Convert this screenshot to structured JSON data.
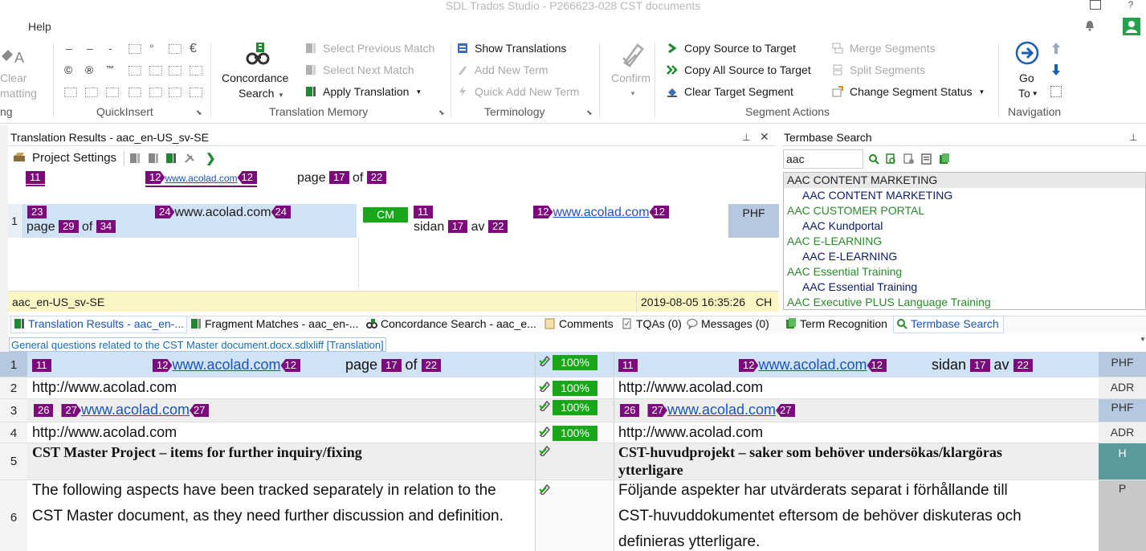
{
  "window": {
    "title": "SDL Trados Studio - P266623-028 CST documents"
  },
  "menu": {
    "help": "Help"
  },
  "ribbon": {
    "clear_formatting": [
      "Clear",
      "matting"
    ],
    "quickinsert": {
      "row1": [
        "–",
        "–",
        "-",
        "°",
        "€"
      ],
      "label": "QuickInsert",
      "symbols": [
        "©",
        "®",
        "™"
      ]
    },
    "concordance": {
      "line1": "Concordance",
      "line2": "Search"
    },
    "tm": {
      "select_prev": "Select Previous Match",
      "select_next": "Select Next Match",
      "apply": "Apply Translation",
      "label": "Translation Memory"
    },
    "terminology": {
      "show": "Show Translations",
      "add_new": "Add New Term",
      "quick_add": "Quick Add New Term",
      "label": "Terminology"
    },
    "confirm": "Confirm",
    "segment_actions": {
      "copy_source": "Copy Source to Target",
      "copy_all": "Copy All Source to Target",
      "clear_target": "Clear Target Segment",
      "merge": "Merge Segments",
      "split": "Split Segments",
      "change_status": "Change Segment Status",
      "label": "Segment Actions"
    },
    "navigation": {
      "go": "Go",
      "to": "To",
      "label": "Navigation"
    },
    "g_fragment": "ng"
  },
  "translation_results": {
    "title": "Translation Results - aac_en-US_sv-SE",
    "project_settings": "Project Settings",
    "preview": {
      "t11": "11",
      "t12a": "12",
      "link": "www.acolad.com",
      "t12b": "12",
      "page": "page",
      "t17": "17",
      "of": "of",
      "t22": "22"
    },
    "match": {
      "num": "1",
      "src": {
        "t23": "23",
        "t24a": "24",
        "text": "www.acolad.com",
        "t24b": "24",
        "page": "page",
        "t29": "29",
        "of": "of",
        "t34": "34"
      },
      "status": "CM",
      "tgt": {
        "t11": "11",
        "t12a": "12",
        "link": "www.acolad.com",
        "t12b": "12",
        "sidan": "sidan",
        "t17": "17",
        "av": "av",
        "t22": "22"
      },
      "code": "PHF"
    },
    "footer": {
      "tm": "aac_en-US_sv-SE",
      "date": "2019-08-05 16:35:26",
      "user": "CH"
    }
  },
  "termbase": {
    "title": "Termbase Search",
    "query": "aac",
    "results": [
      {
        "text": "AAC CONTENT MARKETING",
        "level": 0,
        "color": "#222222",
        "bg": "#e8e8e8"
      },
      {
        "text": "AAC CONTENT MARKETING",
        "level": 1,
        "color": "#0a1b6b",
        "bg": ""
      },
      {
        "text": "AAC CUSTOMER PORTAL",
        "level": 0,
        "color": "#2a8a2a",
        "bg": ""
      },
      {
        "text": "AAC Kundportal",
        "level": 1,
        "color": "#0a1b6b",
        "bg": ""
      },
      {
        "text": "AAC E-LEARNING",
        "level": 0,
        "color": "#2a8a2a",
        "bg": ""
      },
      {
        "text": "AAC E-LEARNING",
        "level": 1,
        "color": "#0a1b6b",
        "bg": ""
      },
      {
        "text": "AAC Essential Training",
        "level": 0,
        "color": "#2a8a2a",
        "bg": ""
      },
      {
        "text": "AAC Essential Training",
        "level": 1,
        "color": "#0a1b6b",
        "bg": ""
      },
      {
        "text": "AAC Executive PLUS Language Training",
        "level": 0,
        "color": "#2a8a2a",
        "bg": ""
      }
    ]
  },
  "tabs": [
    {
      "label": "Translation Results - aac_en-...",
      "active": true
    },
    {
      "label": "Fragment Matches - aac_en-..."
    },
    {
      "label": "Concordance Search - aac_e..."
    },
    {
      "label": "Comments"
    },
    {
      "label": "TQAs (0)"
    },
    {
      "label": "Messages (0)"
    },
    {
      "label": "Term Recognition"
    },
    {
      "label": "Termbase Search",
      "active": true
    }
  ],
  "editor": {
    "file": "General questions related to the CST Master document.docx.sdlxliff [Translation]",
    "rows": [
      {
        "num": "1",
        "match": "100%",
        "code": "PHF",
        "src": {
          "t11": "11",
          "t12a": "12",
          "link": "www.acolad.com",
          "t12b": "12",
          "page": "page",
          "t17": "17",
          "of": "of",
          "t22": "22"
        },
        "tgt": {
          "t11": "11",
          "t12a": "12",
          "link": "www.acolad.com",
          "t12b": "12",
          "sidan": "sidan",
          "t17": "17",
          "av": "av",
          "t22": "22"
        }
      },
      {
        "num": "2",
        "match": "100%",
        "code": "ADR",
        "src": "http://www.acolad.com",
        "tgt": "http://www.acolad.com"
      },
      {
        "num": "3",
        "match": "100%",
        "code": "PHF",
        "src": {
          "t26": "26",
          "t27a": "27",
          "link": "www.acolad.com",
          "t27b": "27"
        },
        "tgt": {
          "t26": "26",
          "t27a": "27",
          "link": "www.acolad.com",
          "t27b": "27"
        }
      },
      {
        "num": "4",
        "match": "100%",
        "code": "ADR",
        "src": "http://www.acolad.com",
        "tgt": "http://www.acolad.com"
      },
      {
        "num": "5",
        "code": "H",
        "src": "CST Master Project – items for further inquiry/fixing",
        "tgt1": "CST-huvudprojekt – saker som behöver undersökas/klargöras",
        "tgt2": "ytterligare"
      },
      {
        "num": "6",
        "code": "P",
        "src1": "The following aspects have been tracked separately in relation to the",
        "src2": "CST Master document, as they need further discussion and definition.",
        "tgt1": "Följande aspekter har utvärderats separat i förhållande till",
        "tgt2": "CST-huvuddokumentet eftersom de behöver diskuteras och",
        "tgt3": "definieras ytterligare."
      }
    ]
  }
}
